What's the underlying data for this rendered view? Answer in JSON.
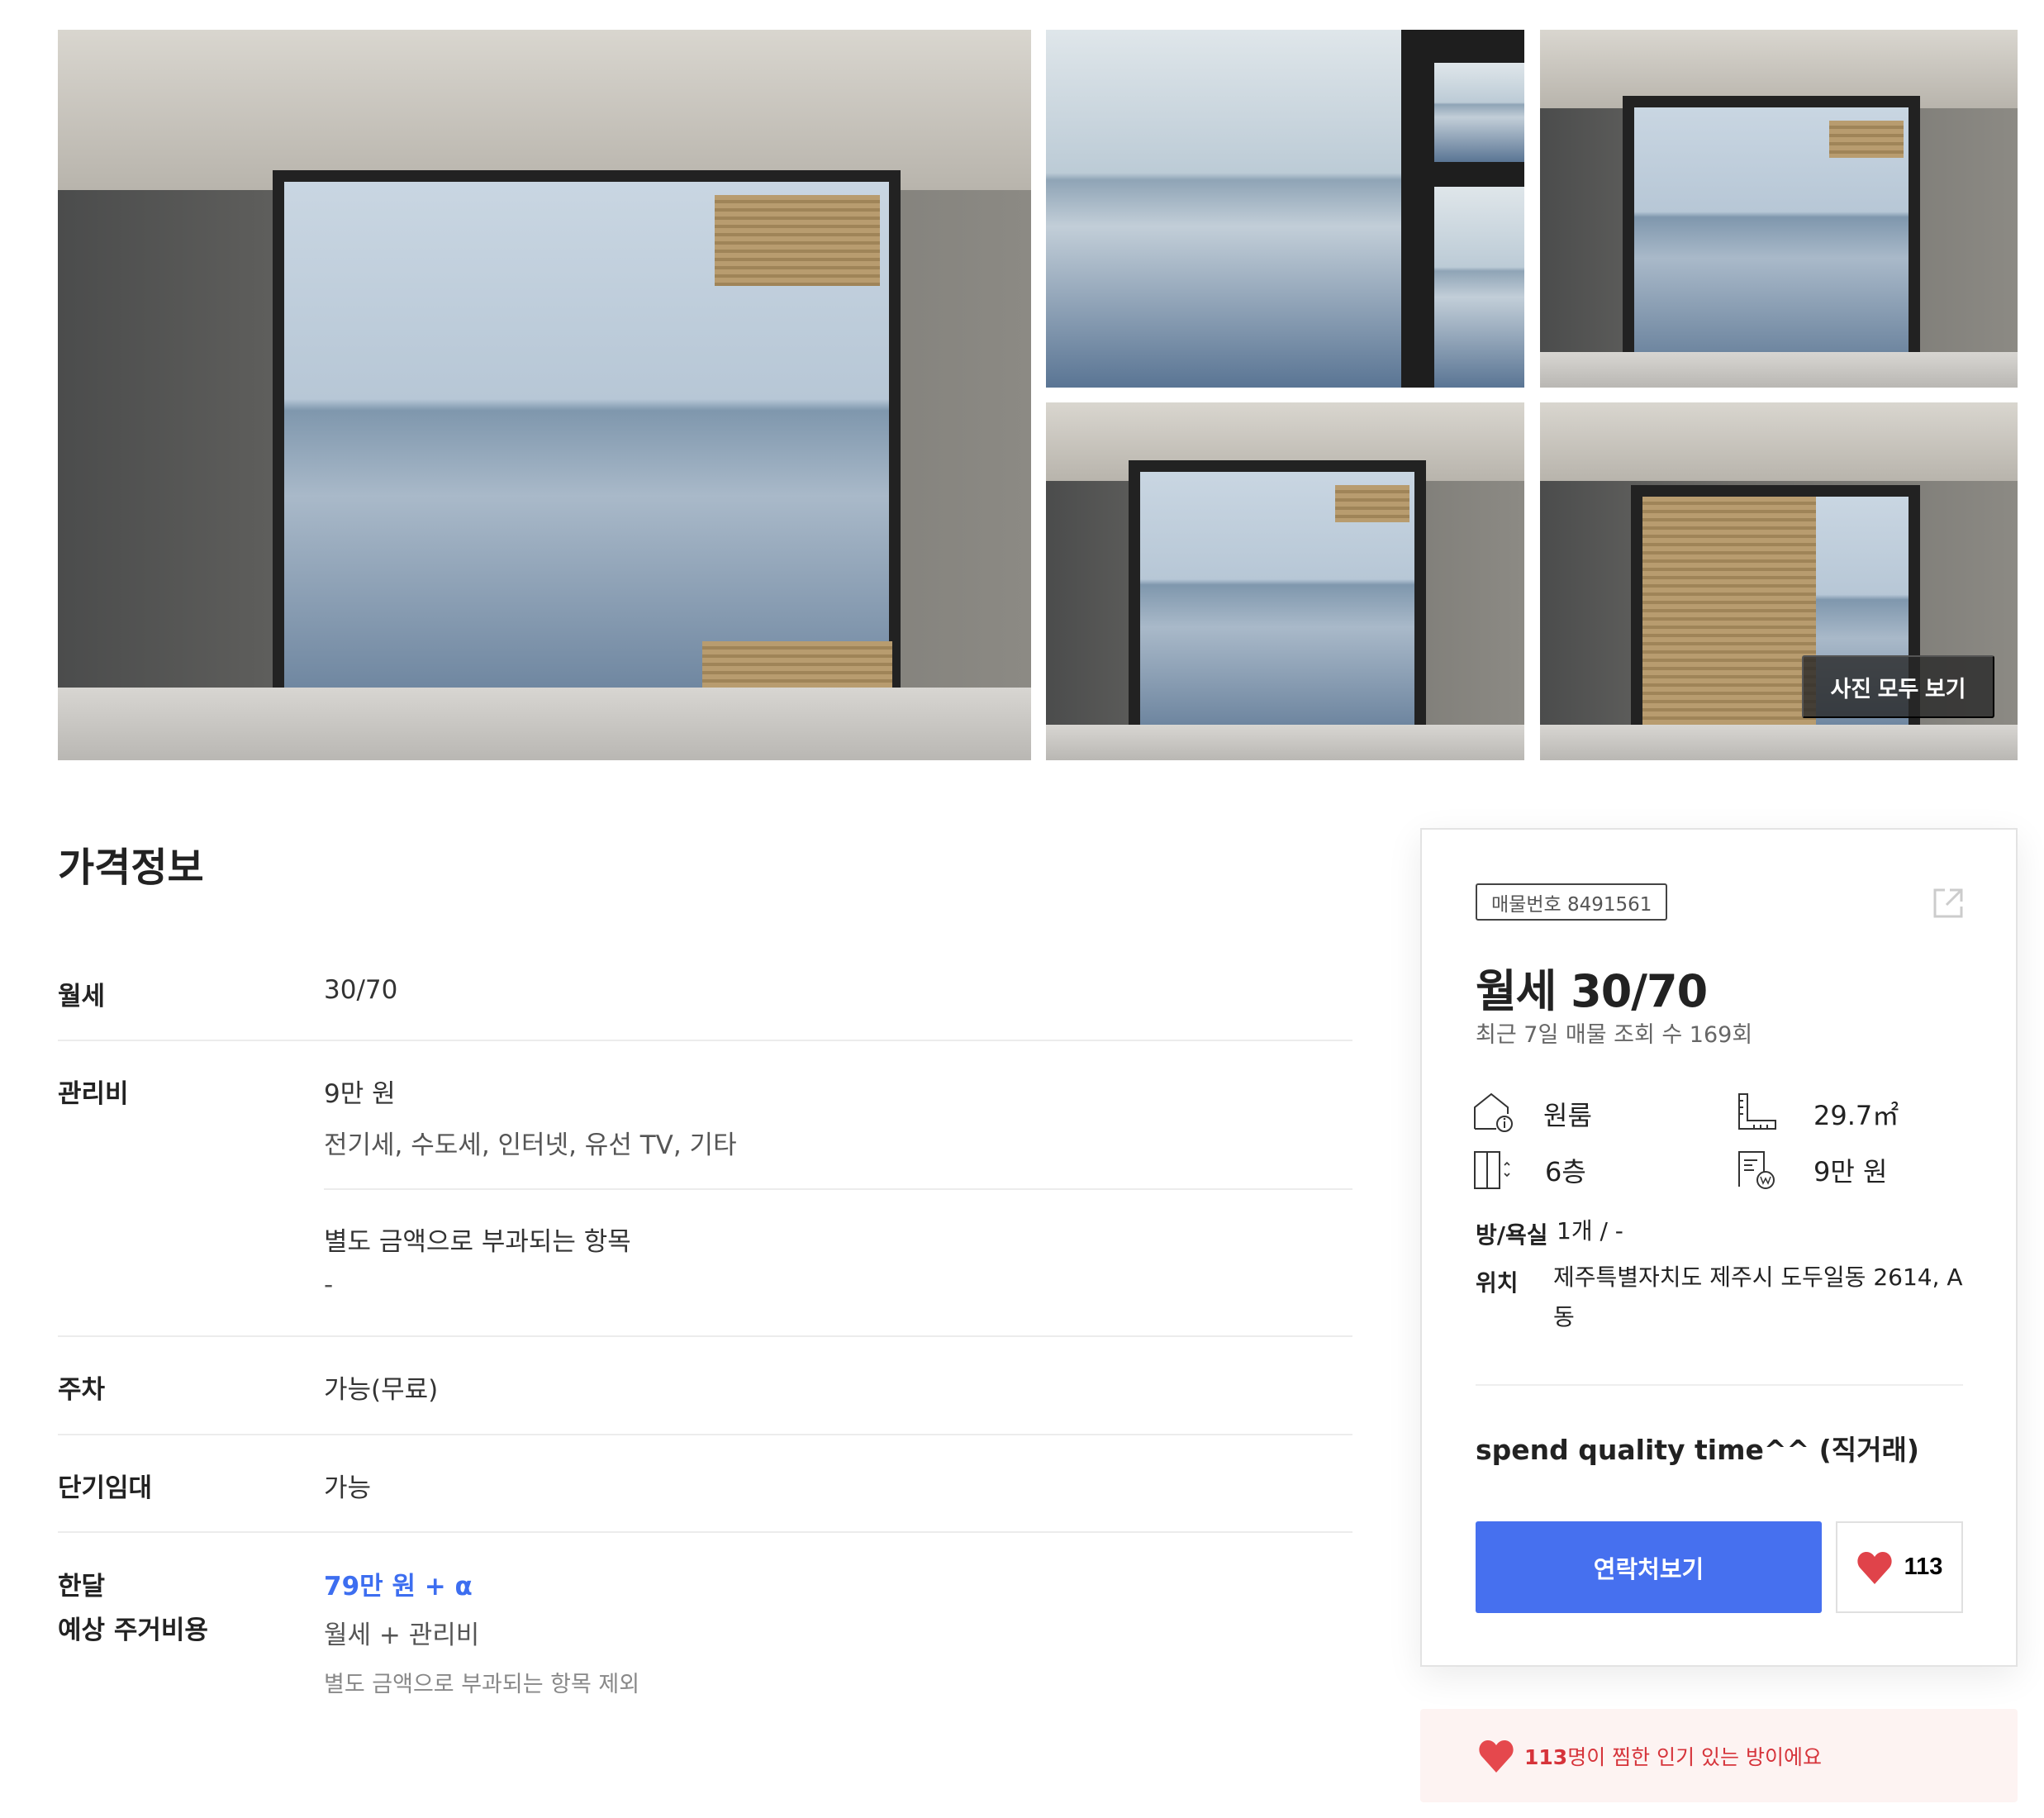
{
  "gallery": {
    "view_all_label": "사진 모두 보기"
  },
  "price_info": {
    "title": "가격정보",
    "rows": [
      {
        "label": "월세",
        "value": "30/70"
      },
      {
        "label": "관리비",
        "value": "9만 원",
        "detail": "전기세, 수도세, 인터넷, 유선 TV, 기타"
      },
      {
        "label": "",
        "value": "별도 금액으로 부과되는 항목",
        "detail": "-"
      },
      {
        "label": "주차",
        "value": "가능(무료)"
      },
      {
        "label": "단기임대",
        "value": "가능"
      },
      {
        "label_line1": "한달",
        "label_line2": "예상 주거비용",
        "value": "79만 원 + α",
        "detail": "월세 + 관리비",
        "note": "별도 금액으로 부과되는 항목 제외"
      }
    ]
  },
  "card": {
    "listing_number": "매물번호 8491561",
    "title": "월세 30/70",
    "views": "최근 7일 매물 조회 수 169회",
    "room_type": "원룸",
    "area": "29.7㎡",
    "floor": "6층",
    "maintenance": "9만 원",
    "rooms_label": "방/욕실",
    "rooms_value": "1개 / -",
    "location_label": "위치",
    "location_value": "제주특별자치도 제주시 도두일동 2614, A동",
    "listing_title": "spend quality time^^ (직거래)",
    "contact_label": "연락처보기",
    "like_count": "113",
    "accent_color": "#4670ef",
    "heart_color": "#e0434a"
  },
  "banner": {
    "count": "113",
    "text": "명이 찜한 인기 있는 방이에요"
  }
}
